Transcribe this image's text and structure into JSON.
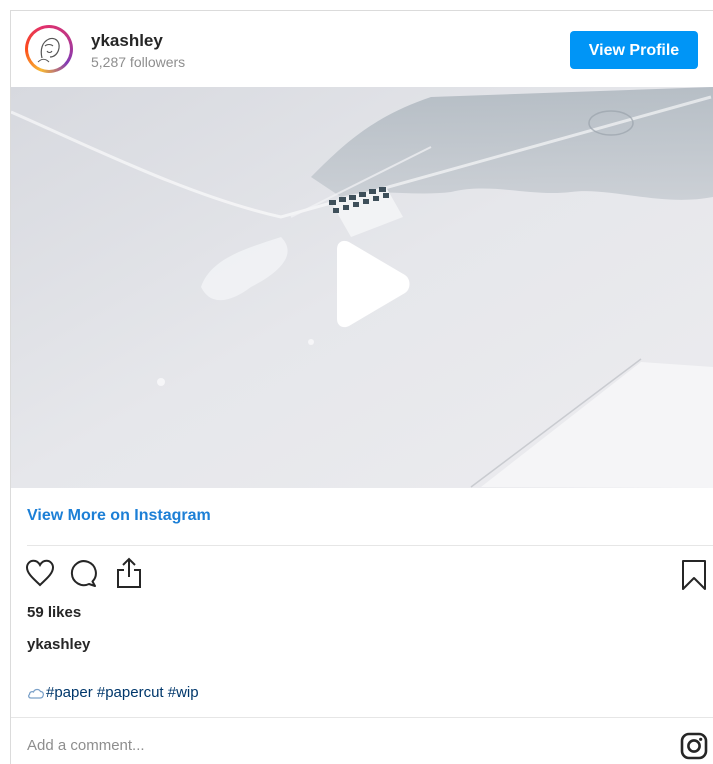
{
  "header": {
    "username": "ykashley",
    "followers": "5,287 followers",
    "view_profile_label": "View Profile"
  },
  "media": {
    "type": "video",
    "play_icon": "play-icon"
  },
  "links": {
    "view_more": "View More on Instagram"
  },
  "actions": {
    "icons": [
      "heart-icon",
      "comment-icon",
      "share-icon",
      "bookmark-icon"
    ]
  },
  "post": {
    "likes": "59 likes",
    "owner": "ykashley",
    "caption": "#paper #papercut #wip"
  },
  "comment": {
    "placeholder": "Add a comment..."
  },
  "colors": {
    "accent": "#0095f6",
    "link": "#1c7fd6",
    "hashtag": "#00376b",
    "muted": "#8e8e8e"
  }
}
